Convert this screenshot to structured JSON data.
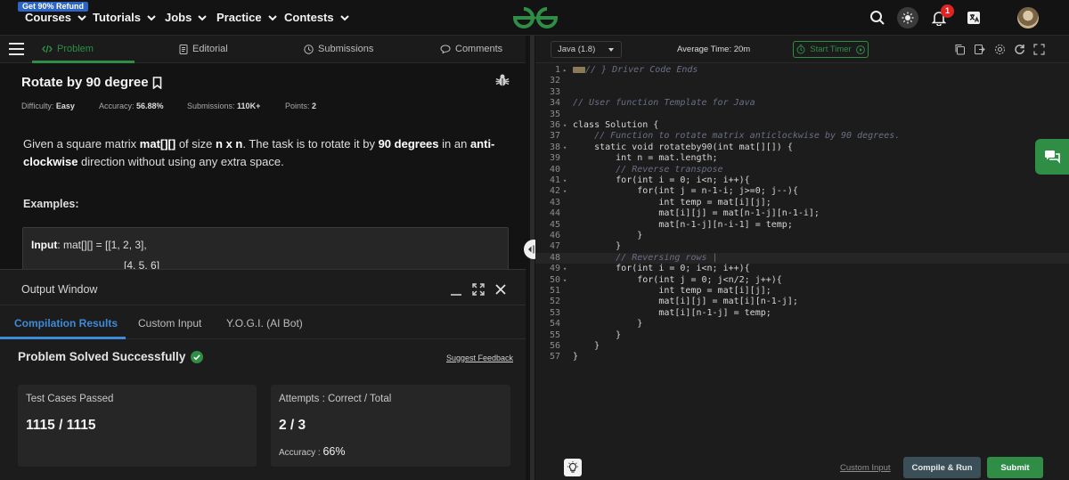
{
  "topnav": {
    "refund_badge": "Get 90% Refund",
    "items": [
      {
        "label": "Courses"
      },
      {
        "label": "Tutorials"
      },
      {
        "label": "Jobs"
      },
      {
        "label": "Practice"
      },
      {
        "label": "Contests"
      }
    ],
    "logo_icon": "gfg-logo-icon",
    "notification_count": "1",
    "icons": [
      "search-icon",
      "theme-toggle-icon",
      "bell-icon",
      "translate-icon",
      "avatar"
    ]
  },
  "problem_tabs": [
    {
      "label": "Problem",
      "icon": "code-icon"
    },
    {
      "label": "Editorial",
      "icon": "document-icon"
    },
    {
      "label": "Submissions",
      "icon": "clock-icon"
    },
    {
      "label": "Comments",
      "icon": "comment-icon"
    }
  ],
  "problem": {
    "title": "Rotate by 90 degree",
    "difficulty_label": "Difficulty:",
    "difficulty": "Easy",
    "accuracy_label": "Accuracy:",
    "accuracy": "56.88%",
    "submissions_label": "Submissions:",
    "submissions": "110K+",
    "points_label": "Points:",
    "points": "2",
    "desc_1": "Given a square matrix ",
    "desc_2": "mat[][]",
    "desc_3": " of size ",
    "desc_4": "n x n",
    "desc_5": ". The task is to rotate it by ",
    "desc_6": "90 degrees",
    "desc_7": " in an ",
    "desc_8": "anti-clockwise",
    "desc_9": " direction without using any extra space.",
    "examples_label": "Examples:",
    "example_input_label": "Input",
    "example_line1": ":  mat[][]  =  [[1,  2,  3],",
    "example_line2": "[4,  5,  6]"
  },
  "output_window": {
    "title": "Output Window",
    "tabs": [
      {
        "label": "Compilation Results"
      },
      {
        "label": "Custom Input"
      },
      {
        "label": "Y.O.G.I. (AI Bot)"
      }
    ],
    "status": "Problem Solved Successfully",
    "feedback_link": "Suggest Feedback",
    "test_cases_label": "Test Cases Passed",
    "test_cases_value": "1115 / 1115",
    "attempts_label": "Attempts : Correct / Total",
    "attempts_value": "2 / 3",
    "accuracy_label": "Accuracy : ",
    "accuracy_value": "66%"
  },
  "editor": {
    "language": "Java (1.8)",
    "average_time": "Average Time: 20m",
    "start_timer": "Start Timer",
    "custom_input": "Custom Input",
    "compile_run": "Compile & Run",
    "submit": "Submit",
    "lines": [
      {
        "n": "1",
        "fold": "▸",
        "text": "// } Driver Code Ends",
        "type": "foldcomment"
      },
      {
        "n": "32",
        "fold": "",
        "text": "",
        "type": "code"
      },
      {
        "n": "33",
        "fold": "",
        "text": "",
        "type": "code"
      },
      {
        "n": "34",
        "fold": "",
        "text": "// User function Template for Java",
        "type": "comment"
      },
      {
        "n": "35",
        "fold": "",
        "text": "",
        "type": "code"
      },
      {
        "n": "36",
        "fold": "▾",
        "text": "class Solution {",
        "type": "code"
      },
      {
        "n": "37",
        "fold": "",
        "text": "    // Function to rotate matrix anticlockwise by 90 degrees.",
        "type": "comment"
      },
      {
        "n": "38",
        "fold": "▾",
        "text": "    static void rotateby90(int mat[][]) {",
        "type": "code"
      },
      {
        "n": "39",
        "fold": "",
        "text": "        int n = mat.length;",
        "type": "code"
      },
      {
        "n": "40",
        "fold": "",
        "text": "        // Reverse transpose",
        "type": "comment"
      },
      {
        "n": "41",
        "fold": "▾",
        "text": "        for(int i = 0; i<n; i++){",
        "type": "code"
      },
      {
        "n": "42",
        "fold": "▾",
        "text": "            for(int j = n-1-i; j>=0; j--){",
        "type": "code"
      },
      {
        "n": "43",
        "fold": "",
        "text": "                int temp = mat[i][j];",
        "type": "code"
      },
      {
        "n": "44",
        "fold": "",
        "text": "                mat[i][j] = mat[n-1-j][n-1-i];",
        "type": "code"
      },
      {
        "n": "45",
        "fold": "",
        "text": "                mat[n-1-j][n-i-1] = temp;",
        "type": "code"
      },
      {
        "n": "46",
        "fold": "",
        "text": "            }",
        "type": "code"
      },
      {
        "n": "47",
        "fold": "",
        "text": "        }",
        "type": "code"
      },
      {
        "n": "48",
        "fold": "",
        "text": "        // Reversing rows |",
        "type": "comment"
      },
      {
        "n": "49",
        "fold": "▾",
        "text": "        for(int i = 0; i<n; i++){",
        "type": "code"
      },
      {
        "n": "50",
        "fold": "▾",
        "text": "            for(int j = 0; j<n/2; j++){",
        "type": "code"
      },
      {
        "n": "51",
        "fold": "",
        "text": "                int temp = mat[i][j];",
        "type": "code"
      },
      {
        "n": "52",
        "fold": "",
        "text": "                mat[i][j] = mat[i][n-1-j];",
        "type": "code"
      },
      {
        "n": "53",
        "fold": "",
        "text": "                mat[i][n-1-j] = temp;",
        "type": "code"
      },
      {
        "n": "54",
        "fold": "",
        "text": "            }",
        "type": "code"
      },
      {
        "n": "55",
        "fold": "",
        "text": "        }",
        "type": "code"
      },
      {
        "n": "56",
        "fold": "",
        "text": "    }",
        "type": "code"
      },
      {
        "n": "57",
        "fold": "",
        "text": "}",
        "type": "code"
      }
    ]
  },
  "colors": {
    "brand_green": "#2f8d46",
    "link_blue": "#3d8bd9",
    "badge_blue": "#2d64c8",
    "notif_red": "#e02424"
  }
}
